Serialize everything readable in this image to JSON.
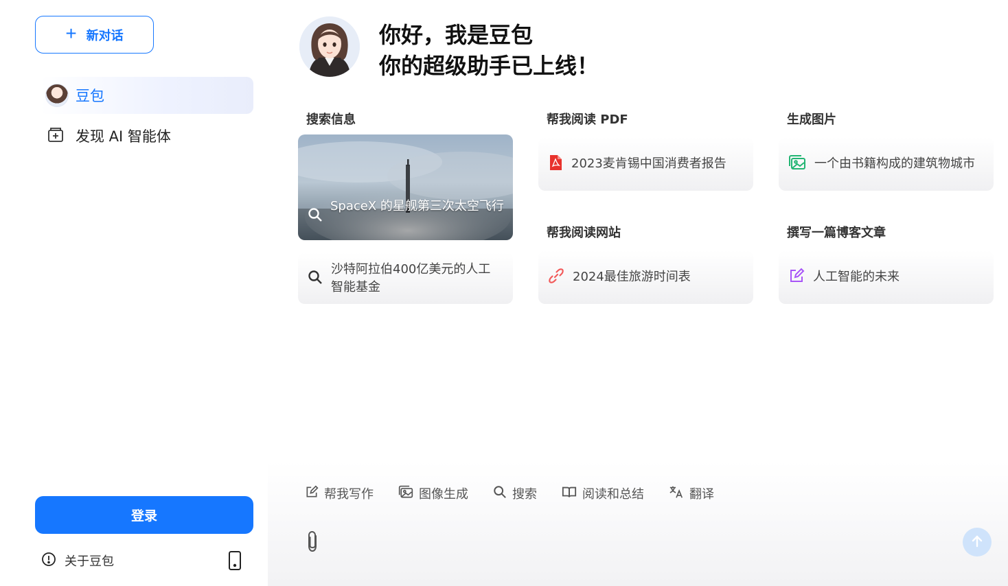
{
  "sidebar": {
    "new_chat_label": "新对话",
    "doubao_label": "豆包",
    "discover_label": "发现 AI 智能体",
    "login_label": "登录",
    "about_label": "关于豆包"
  },
  "hero": {
    "line1": "你好，我是豆包",
    "line2": "你的超级助手已上线！"
  },
  "sections": {
    "search": {
      "title": "搜索信息",
      "featured": "SpaceX 的星舰第三次太空飞行",
      "item": "沙特阿拉伯400亿美元的人工智能基金"
    },
    "read_pdf": {
      "title": "帮我阅读 PDF",
      "item": "2023麦肯锡中国消费者报告"
    },
    "read_site": {
      "title": "帮我阅读网站",
      "item": "2024最佳旅游时间表"
    },
    "gen_image": {
      "title": "生成图片",
      "item": "一个由书籍构成的建筑物城市"
    },
    "blog": {
      "title": "撰写一篇博客文章",
      "item": "人工智能的未来"
    }
  },
  "toolbar": {
    "write": "帮我写作",
    "image": "图像生成",
    "search": "搜索",
    "read": "阅读和总结",
    "translate": "翻译"
  },
  "colors": {
    "accent": "#1677ff",
    "pdf_red": "#e8322c",
    "link_red": "#f25a5a",
    "image_green": "#22b573",
    "blog_purple": "#a855f7"
  }
}
